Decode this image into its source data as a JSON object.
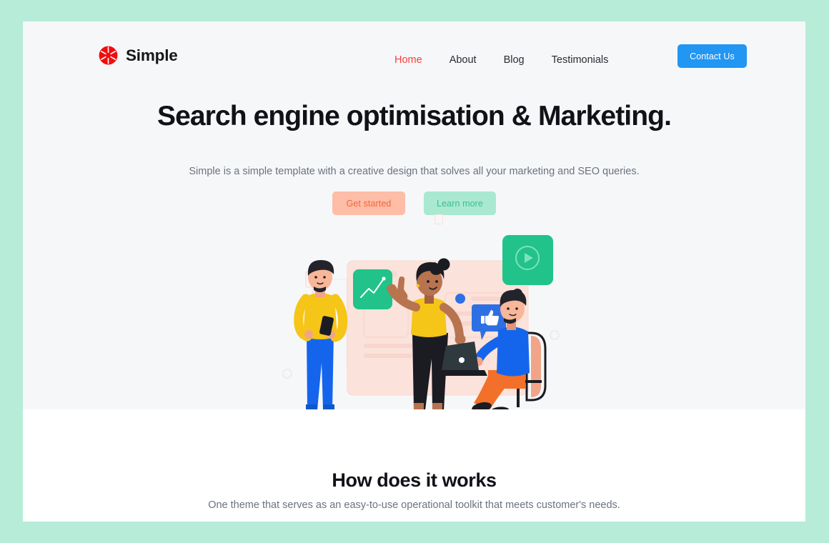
{
  "theme": {
    "outer_background": "#b6ecd8",
    "page_background": "#ffffff",
    "hero_background": "#f6f7f9",
    "accent_red": "#f6403a",
    "accent_blue": "#2196f3",
    "accent_green": "#2ecc9a",
    "accent_peach": "#fdbda6",
    "accent_mint": "#a9e9d1",
    "heading_color": "#111118",
    "body_text_color": "#6b7280"
  },
  "header": {
    "brand": {
      "name": "Simple",
      "logo_icon": "camera-aperture-icon",
      "logo_color": "#f20d0d"
    },
    "nav": [
      {
        "label": "Home",
        "active": true
      },
      {
        "label": "About",
        "active": false
      },
      {
        "label": "Blog",
        "active": false
      },
      {
        "label": "Testimonials",
        "active": false
      }
    ],
    "contact_button": "Contact Us"
  },
  "hero": {
    "title": "Search engine optimisation & Marketing.",
    "subtitle": "Simple is a simple template with a creative design that solves all your marketing and SEO queries.",
    "primary_cta": "Get started",
    "secondary_cta": "Learn more",
    "illustration": {
      "alt": "team-collaboration-illustration",
      "elements": [
        "browser-window-panel",
        "growth-chart-card",
        "video-play-card",
        "thumbs-up-bubble",
        "standing-man-with-phone",
        "woman-presenting",
        "seated-man-with-laptop",
        "office-chair",
        "chat-bubble-outline",
        "decorative-circles"
      ]
    }
  },
  "how_it_works": {
    "title": "How does it works",
    "subtitle": "One theme that serves as an easy-to-use operational toolkit that meets customer's needs."
  }
}
